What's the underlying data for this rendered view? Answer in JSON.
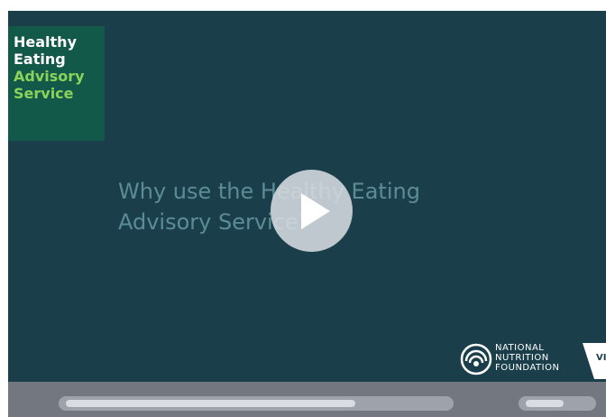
{
  "logo": {
    "line1": "Healthy",
    "line2": "Eating",
    "line3": "Advisory",
    "line4": "Service"
  },
  "slide": {
    "headline_line1": "Why use the Healthy Eating",
    "headline_line2": "Advisory Service?"
  },
  "partners": {
    "nnf_line1": "NATIONAL",
    "nnf_line2": "NUTRITION",
    "nnf_line3": "FOUNDATION",
    "vic_text": "VIC"
  },
  "player": {
    "play_icon": "play-icon",
    "progress_fraction": 0.76,
    "volume_fraction": 0.6
  },
  "colors": {
    "stage_bg": "#1a3f4b",
    "logo_bg": "#13594a",
    "logo_accent": "#8ad35a",
    "headline": "#5b8c95",
    "controls_bg": "#727780"
  }
}
